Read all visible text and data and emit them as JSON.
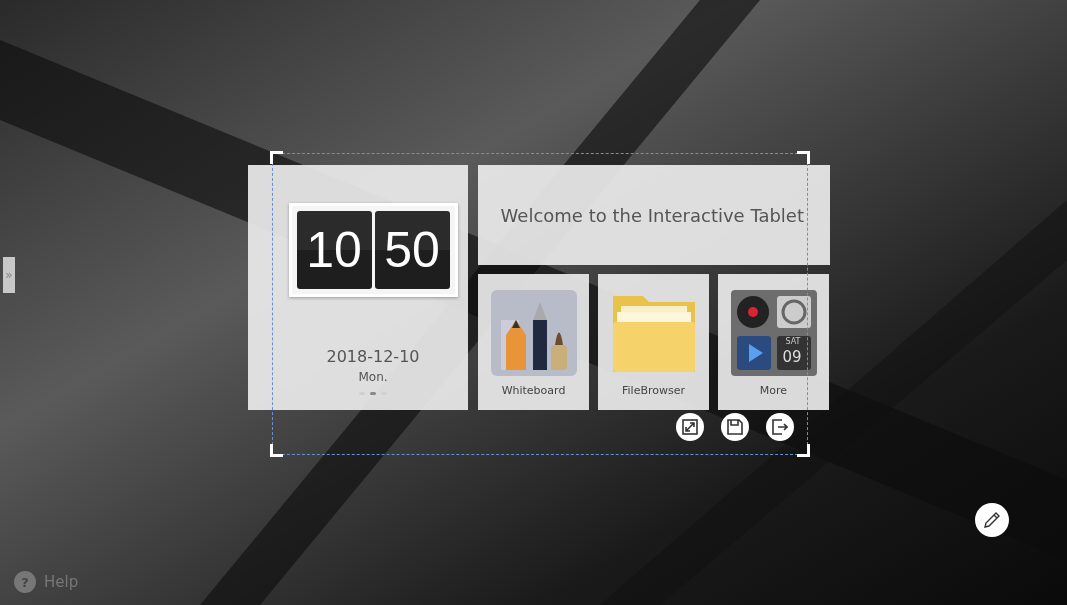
{
  "side_handle": "»",
  "clock": {
    "hours": "10",
    "minutes": "50"
  },
  "date": "2018-12-10",
  "weekday": "Mon.",
  "page_dots": [
    {
      "selected": false
    },
    {
      "selected": true
    },
    {
      "selected": false
    }
  ],
  "welcome": "Welcome to the Interactive Tablet",
  "apps": [
    {
      "label": "Whiteboard",
      "kind": "whiteboard"
    },
    {
      "label": "FileBrowser",
      "kind": "folder"
    },
    {
      "label": "More",
      "kind": "more",
      "day": "SAT",
      "date": "09"
    }
  ],
  "selection_tools": [
    {
      "kind": "expand"
    },
    {
      "kind": "save"
    },
    {
      "kind": "exit"
    }
  ],
  "help": {
    "icon": "?",
    "label": "Help"
  }
}
